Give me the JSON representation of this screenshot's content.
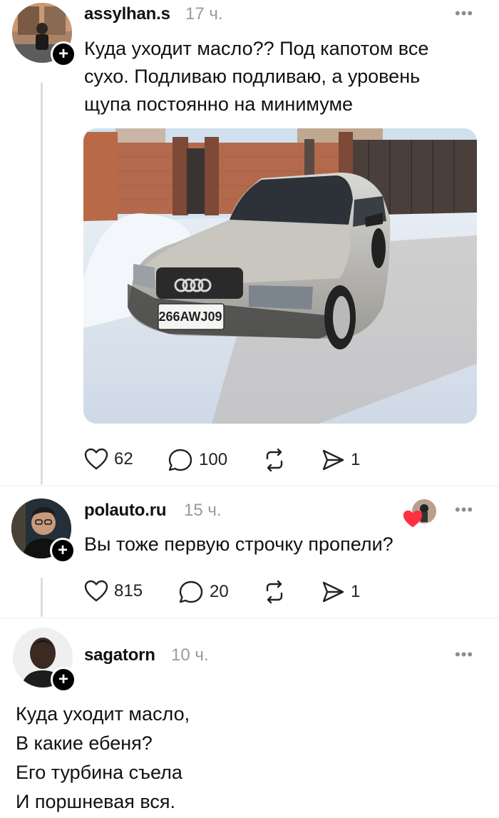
{
  "posts": [
    {
      "username": "assylhan.s",
      "time": "17 ч.",
      "text": [
        "Куда уходит масло?? Под капотом все",
        "сухо. Подливаю подливаю, а уровень",
        "щупа постоянно на минимуме"
      ],
      "image_alt": "Серебристый седан на заснеженном дворе",
      "plate": "266AWJ09",
      "likes": "62",
      "comments": "100",
      "shares": "1"
    },
    {
      "username": "polauto.ru",
      "time": "15 ч.",
      "text": [
        "Вы тоже первую строчку пропели?"
      ],
      "likes": "815",
      "comments": "20",
      "shares": "1"
    },
    {
      "username": "sagatorn",
      "time": "10 ч.",
      "text": [
        "Куда уходит масло,",
        "В какие ебеня?",
        "Его турбина съела",
        "И поршневая вся."
      ]
    }
  ],
  "ui": {
    "more": "•••",
    "follow": "+"
  },
  "colors": {
    "like_heart": "#ff3040",
    "separator": "#ececec",
    "muted": "#9a9a9a"
  }
}
